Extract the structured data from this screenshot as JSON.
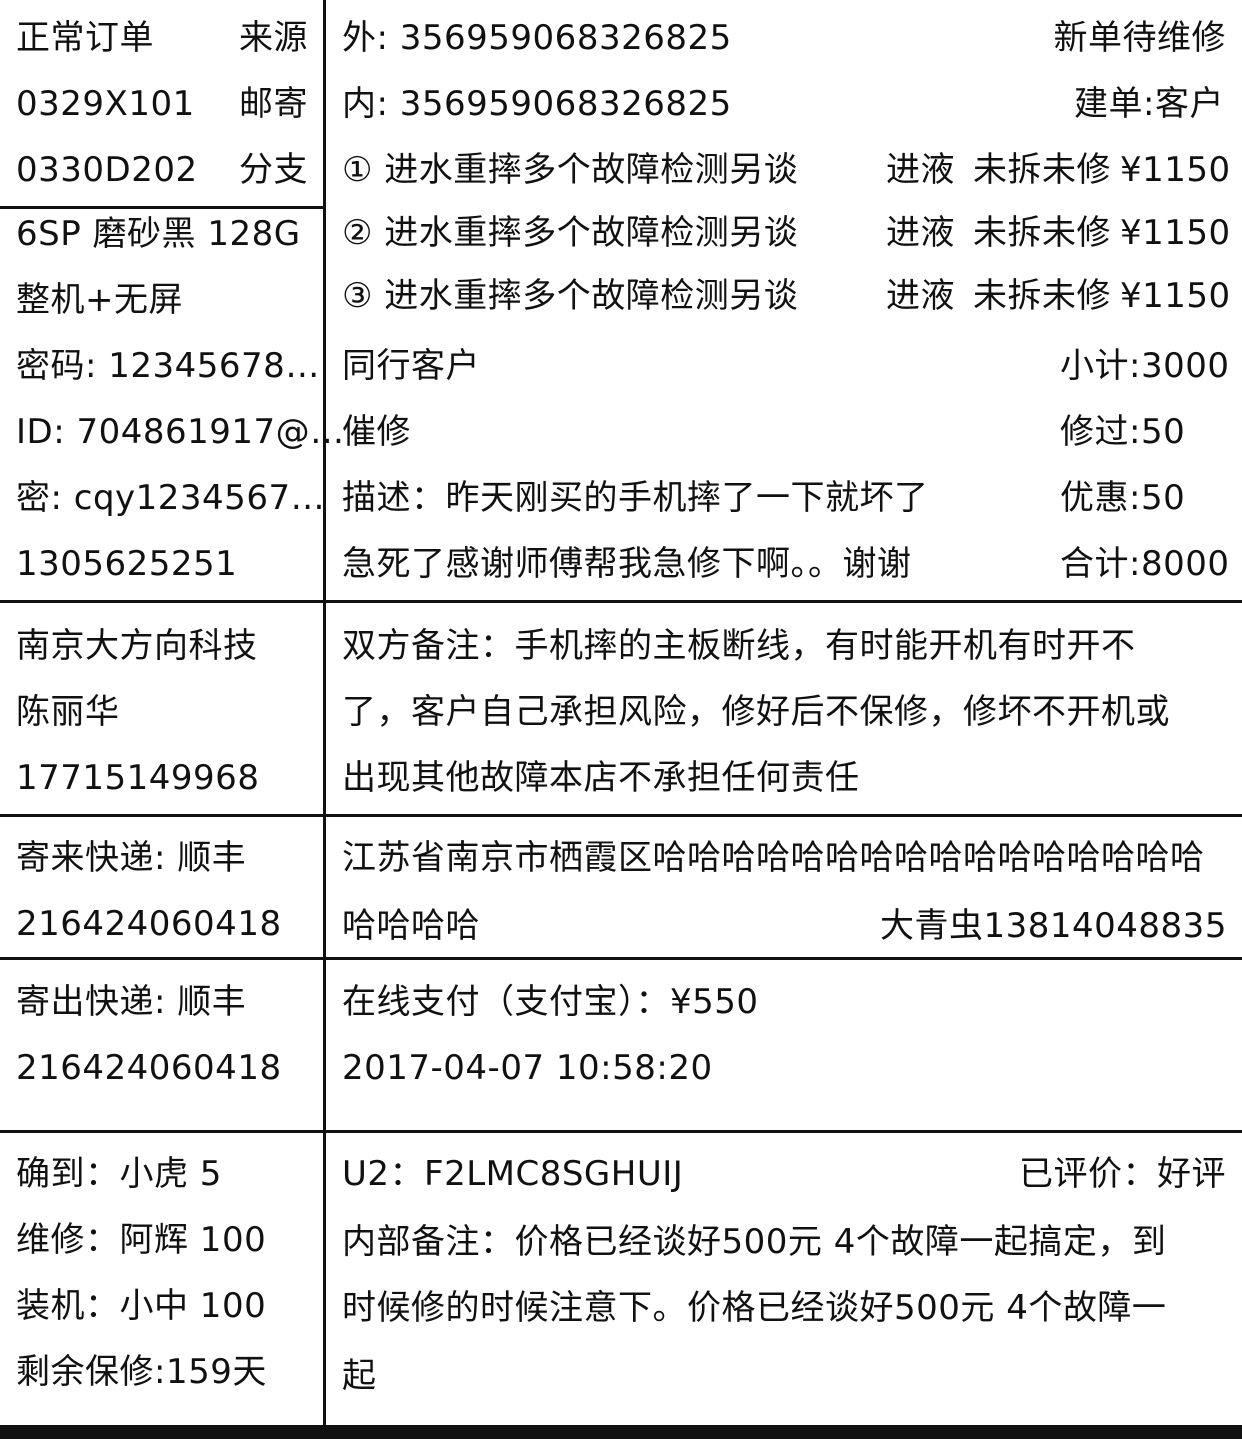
{
  "order": {
    "type": "正常订单",
    "source_label": "来源",
    "code1": "0329X101",
    "channel": "邮寄",
    "code2": "0330D202",
    "branch": "分支"
  },
  "device": {
    "model": "6SP 磨砂黑 128G",
    "package": "整机+无屏",
    "password": "密码: 12345678…",
    "apple_id": "ID: 704861917@…",
    "id_password": "密: cqy1234567…",
    "phone": "1305625251"
  },
  "imei": {
    "outer": "外: 356959068326825",
    "inner": "内: 356959068326825",
    "status": "新单待维修",
    "created_by": "建单:客户"
  },
  "faults": [
    {
      "desc": "① 进水重摔多个故障检测另谈",
      "kind": "进液",
      "state": "未拆未修",
      "price": "¥1150"
    },
    {
      "desc": "② 进水重摔多个故障检测另谈",
      "kind": "进液",
      "state": "未拆未修",
      "price": "¥1150"
    },
    {
      "desc": "③ 进水重摔多个故障检测另谈",
      "kind": "进液",
      "state": "未拆未修",
      "price": "¥1150"
    }
  ],
  "summary": {
    "customer_type": "同行客户",
    "urge": "催修",
    "desc_line1": "描述：昨天刚买的手机摔了一下就坏了",
    "desc_line2": "急死了感谢师傅帮我急修下啊。。谢谢",
    "subtotal": "小计:3000",
    "repaired": "修过:50",
    "discount": "优惠:50",
    "total": "合计:8000"
  },
  "customer": {
    "company": "南京大方向科技",
    "name": "陈丽华",
    "phone": "17715149968"
  },
  "remarks": {
    "line1": "双方备注：手机摔的主板断线，有时能开机有时开不",
    "line2": "了，客户自己承担风险，修好后不保修，修坏不开机或",
    "line3": "出现其他故障本店不承担任何责任"
  },
  "inbound_shipping": {
    "carrier": "寄来快递: 顺丰",
    "tracking": "216424060418"
  },
  "address": {
    "line1": "江苏省南京市栖霞区哈哈哈哈哈哈哈哈哈哈哈哈哈哈哈哈",
    "line2": "哈哈哈哈",
    "contact": "大青虫13814048835"
  },
  "outbound_shipping": {
    "carrier": "寄出快递: 顺丰",
    "tracking": "216424060418"
  },
  "payment": {
    "method": "在线支付（支付宝）：¥550",
    "time": "2017-04-07 10:58:20"
  },
  "staff": {
    "confirm": "确到：小虎  5",
    "repair": "维修：阿辉  100",
    "assemble": "装机：小中  100",
    "warranty": "剩余保修:159天"
  },
  "internal": {
    "u2": "U2：F2LMC8SGHUIJ",
    "rating": "已评价：好评",
    "note_line1": "内部备注：价格已经谈好500元 4个故障一起搞定，到",
    "note_line2": "时候修的时候注意下。价格已经谈好500元 4个故障一",
    "note_line3": "起"
  }
}
